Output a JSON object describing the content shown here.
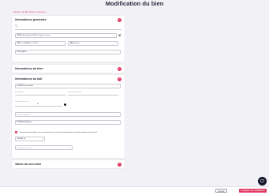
{
  "page": {
    "title": "Modification du bien",
    "breadcrumb": "29 Rue de Bordeaux Toulouse"
  },
  "general": {
    "title": "Informations générales",
    "name_label": "Nom",
    "name_value": "Tiqui",
    "address_label": "Adresse",
    "address_value": "29 Rue de Bordeaux 31200, Toulouse, France",
    "reference_label": "Réf",
    "reference_value": "BIEN_1_0000000_1_0715_0",
    "type_label": "Type",
    "type_value": "Appartement",
    "status_label": "Statut du bien",
    "status_value": "Non proposé"
  },
  "bien": {
    "title": "Informations du bien"
  },
  "bail": {
    "title": "Informations du bail",
    "type_label": "Type de bail",
    "type_value": "Location non meublée",
    "date_debut_label": "Date de début",
    "date_fin_label": "Date de fin (optionnel)",
    "duree_label": "Durée du bail (en mois)",
    "duree_value": "36",
    "field_date_placeholder": "Date de signature",
    "usage_label": "Destination du bien",
    "usage_value": "Résidence principale",
    "checkbox_text": "Le locataire peut régulariser une ou trois grands mois la hausse de bail du logement (la durée de dénonce) du montant",
    "frequency_label": "Fréquence",
    "frequency_value": "Tous les 1er",
    "notice_placeholder": "Repositionner le bien"
  },
  "valeur": {
    "title": "Valeur du mon bien"
  },
  "footer": {
    "cancel_label": "Annuler",
    "save_label": "Enregistrer les modifications"
  },
  "colors": {
    "accent": "#e03a63",
    "title": "#2a2a3c",
    "background": "#f2f2f6"
  },
  "icons": {
    "collapse": "minus-icon",
    "chevron": "chevron-down-icon",
    "locate": "crosshair-icon",
    "info": "info-icon",
    "chat": "chat-icon"
  }
}
